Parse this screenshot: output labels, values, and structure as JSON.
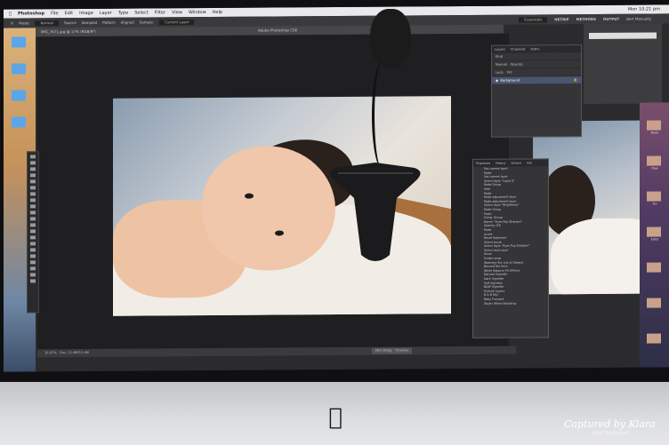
{
  "menubar": {
    "app": "Photoshop",
    "items": [
      "File",
      "Edit",
      "Image",
      "Layer",
      "Type",
      "Select",
      "Filter",
      "View",
      "Window",
      "Help"
    ],
    "clock": "Mon 10:21 pm"
  },
  "options_bar": {
    "mode_label": "Mode:",
    "mode_value": "Normal",
    "source": "Source",
    "sampled": "Sampled",
    "pattern": "Pattern",
    "aligned": "Aligned",
    "sample": "Sample:",
    "sample_value": "Current Layer",
    "workspace": "Essentials",
    "nav": [
      "NETRIP",
      "METHODS",
      "OUTPUT"
    ],
    "user": "Bert Manually"
  },
  "document": {
    "tab": "IMG_7671.jpg @ 17% (RGB/8*)",
    "app_title": "Adobe Photoshop CS6",
    "zoom": "16.67%",
    "status": "Doc: 11.4M/11.4M"
  },
  "bottom_tabs": [
    "Mini Bridge",
    "Timeline"
  ],
  "layers_panel": {
    "tabs": [
      "Layers",
      "Channels",
      "Paths"
    ],
    "kind": "Kind",
    "blend": "Normal",
    "opacity": "Opacity:",
    "fill": "Fill:",
    "lock": "Lock:",
    "layer_name": "Background"
  },
  "actions_panel": {
    "tabs": [
      "Properties",
      "History",
      "Actions",
      "Info"
    ],
    "items": [
      "Set current layer",
      "Make",
      "Set current layer",
      "Select layer \"Layer 0\"",
      "Make Group",
      "Hide",
      "Make",
      "Make adjustment layer",
      "Make adjustment layer",
      "Select layer \"Brightness\"",
      "Make Group",
      "Paste",
      "Using: Group",
      "Name: \"Eyes Pop Sharpen\"",
      "Opacity: 0%",
      "Make",
      "Invert",
      "Reset Swatches",
      "Select brush",
      "Select layer \"Eyes Pop Sharpen\"",
      "Select back layer",
      "Show",
      "Create snap",
      "Washing (For Low & Sleepy)",
      "Beyond the Intro",
      "White Balance Fix Effects",
      "Natural Vignette",
      "Dark Vignette",
      "Soft Vignette",
      "B&W Vignette",
      "Portrait Layers",
      "B & B Styl",
      "Baby Focused",
      "Studio White Backdrop"
    ]
  },
  "right_desktop": {
    "labels": [
      "Book",
      "Raw",
      "Fix",
      "Edits"
    ]
  },
  "watermark": {
    "line1": "Captured by Klara",
    "line2": "PHOTOGRAPHY"
  }
}
